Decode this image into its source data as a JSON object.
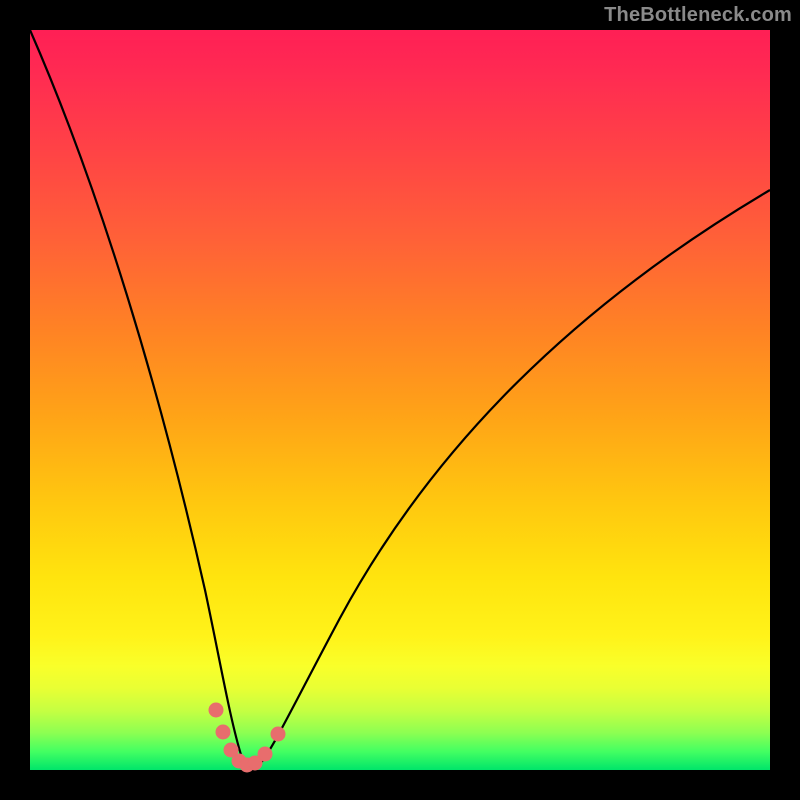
{
  "watermark": "TheBottleneck.com",
  "chart_data": {
    "type": "line",
    "title": "",
    "xlabel": "",
    "ylabel": "",
    "xlim": [
      0,
      100
    ],
    "ylim": [
      0,
      100
    ],
    "grid": false,
    "series": [
      {
        "name": "bottleneck-curve",
        "x": [
          0,
          4,
          8,
          12,
          15,
          18,
          20,
          22,
          24,
          26,
          27,
          28,
          29,
          30,
          31,
          33,
          36,
          42,
          50,
          60,
          70,
          80,
          90,
          100
        ],
        "values": [
          100,
          84,
          70,
          56,
          44,
          33,
          25,
          18,
          12,
          6,
          3,
          1,
          0,
          0,
          1,
          3,
          7,
          16,
          28,
          41,
          52,
          62,
          71,
          78
        ]
      }
    ],
    "markers": {
      "name": "highlighted-points",
      "color": "#e86d6d",
      "x": [
        25.2,
        26.0,
        27.0,
        28.0,
        29.0,
        30.2,
        31.6,
        33.2
      ],
      "y": [
        8.5,
        5.0,
        2.5,
        1.0,
        0.5,
        0.8,
        2.0,
        4.5
      ]
    },
    "gradient_stops": [
      {
        "pos": 0.0,
        "color": "#ff1f55"
      },
      {
        "pos": 0.5,
        "color": "#ffa317"
      },
      {
        "pos": 0.82,
        "color": "#fff31a"
      },
      {
        "pos": 1.0,
        "color": "#00e56a"
      }
    ]
  }
}
